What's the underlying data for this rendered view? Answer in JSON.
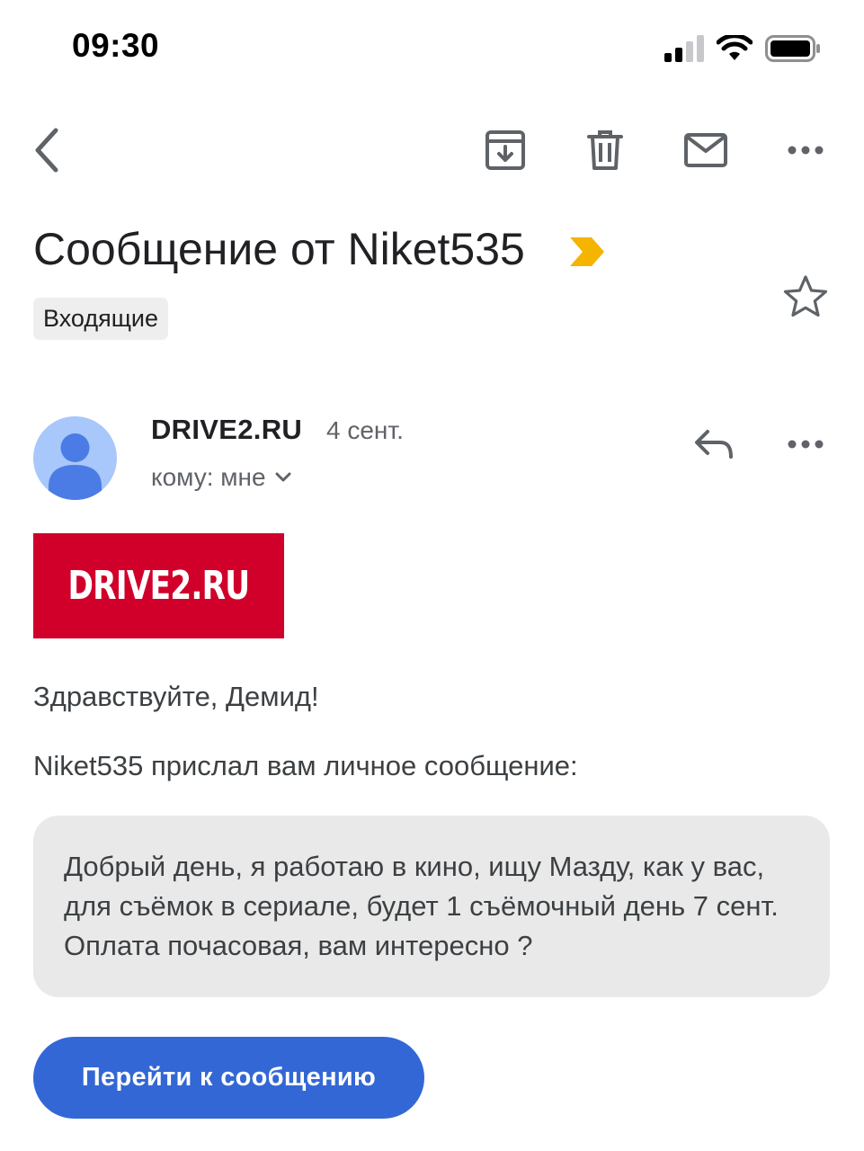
{
  "status_bar": {
    "time": "09:30"
  },
  "toolbar": {
    "back_icon": "chevron-left-icon",
    "archive_icon": "archive-icon",
    "delete_icon": "trash-icon",
    "mark_unread_icon": "mail-icon",
    "more_icon": "more-horizontal-icon"
  },
  "email": {
    "subject": "Сообщение от Niket535",
    "label": "Входящие",
    "importance_color": "#f4b400",
    "sender": {
      "name": "DRIVE2.RU",
      "date": "4 сент.",
      "recipient": "кому: мне"
    },
    "banner": {
      "text": "DRIVE2.RU",
      "color": "#d0002b"
    },
    "greeting": "Здравствуйте, Демид!",
    "intro": "Niket535 прислал вам личное сообщение:",
    "message": "Добрый день, я работаю в кино, ищу Мазду, как у вас, для съёмок в сериале, будет 1 съёмочный день 7 сент. Оплата почасовая, вам интересно ?",
    "cta_label": "Перейти к сообщению",
    "cta_color": "#3367d6"
  }
}
